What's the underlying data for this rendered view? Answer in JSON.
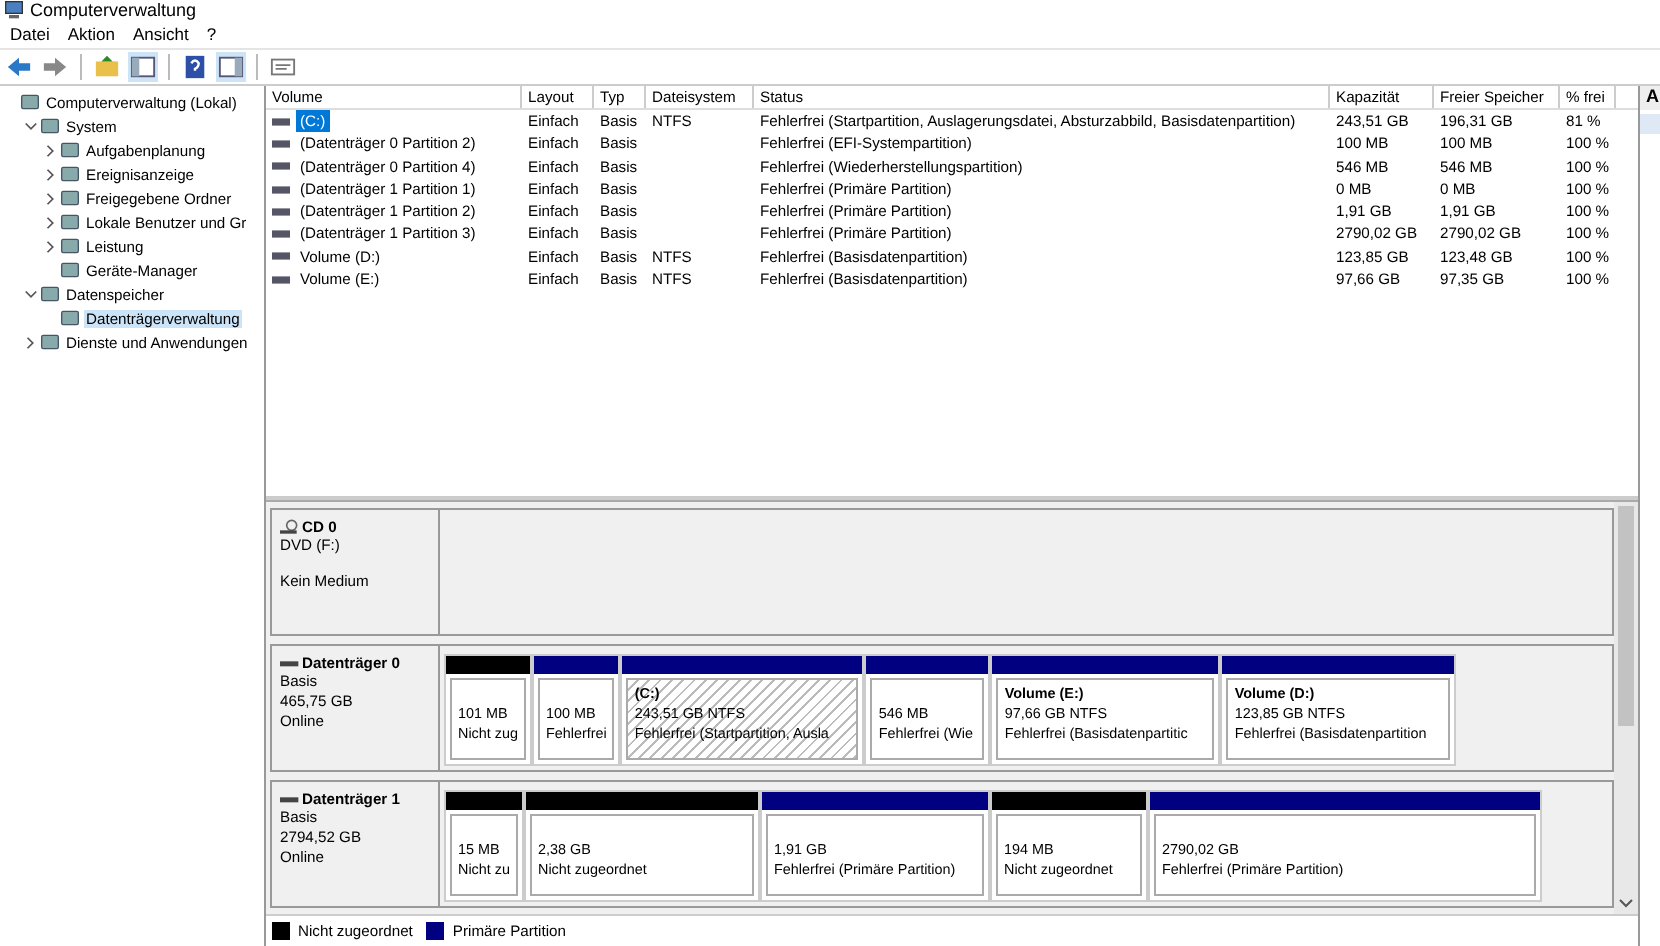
{
  "window": {
    "title": "Computerverwaltung"
  },
  "menu": [
    "Datei",
    "Aktion",
    "Ansicht",
    "?"
  ],
  "tree": [
    {
      "label": "Computerverwaltung (Lokal)",
      "selected": false,
      "children": [
        {
          "label": "System",
          "expanded": true,
          "selected": false,
          "children": [
            {
              "label": "Aufgabenplanung",
              "expanded": false,
              "selected": false
            },
            {
              "label": "Ereignisanzeige",
              "expanded": false,
              "selected": false
            },
            {
              "label": "Freigegebene Ordner",
              "expanded": false,
              "selected": false
            },
            {
              "label": "Lokale Benutzer und Gr",
              "expanded": false,
              "selected": false
            },
            {
              "label": "Leistung",
              "expanded": false,
              "selected": false
            },
            {
              "label": "Geräte-Manager",
              "selected": false
            }
          ]
        },
        {
          "label": "Datenspeicher",
          "expanded": true,
          "selected": false,
          "children": [
            {
              "label": "Datenträgerverwaltung",
              "selected": true
            }
          ]
        },
        {
          "label": "Dienste und Anwendungen",
          "expanded": false,
          "selected": false
        }
      ]
    }
  ],
  "table": {
    "columns": [
      "Volume",
      "Layout",
      "Typ",
      "Dateisystem",
      "Status",
      "Kapazität",
      "Freier Speicher",
      "% frei"
    ],
    "rows": [
      {
        "selected": true,
        "volume": "(C:)",
        "layout": "Einfach",
        "type": "Basis",
        "filesystem": "NTFS",
        "status": "Fehlerfrei (Startpartition, Auslagerungsdatei, Absturzabbild, Basisdatenpartition)",
        "capacity": "243,51 GB",
        "free": "196,31 GB",
        "free_pct": "81 %"
      },
      {
        "selected": false,
        "volume": "(Datenträger 0 Partition 2)",
        "layout": "Einfach",
        "type": "Basis",
        "status": "Fehlerfrei (EFI-Systempartition)",
        "capacity": "100 MB",
        "free": "100 MB",
        "free_pct": "100 %"
      },
      {
        "selected": false,
        "volume": "(Datenträger 0 Partition 4)",
        "layout": "Einfach",
        "type": "Basis",
        "status": "Fehlerfrei (Wiederherstellungspartition)",
        "capacity": "546 MB",
        "free": "546 MB",
        "free_pct": "100 %"
      },
      {
        "selected": false,
        "volume": "(Datenträger 1 Partition 1)",
        "layout": "Einfach",
        "type": "Basis",
        "status": "Fehlerfrei (Primäre Partition)",
        "capacity": "0 MB",
        "free": "0 MB",
        "free_pct": "100 %"
      },
      {
        "selected": false,
        "volume": "(Datenträger 1 Partition 2)",
        "layout": "Einfach",
        "type": "Basis",
        "status": "Fehlerfrei (Primäre Partition)",
        "capacity": "1,91 GB",
        "free": "1,91 GB",
        "free_pct": "100 %"
      },
      {
        "selected": false,
        "volume": "(Datenträger 1 Partition 3)",
        "layout": "Einfach",
        "type": "Basis",
        "status": "Fehlerfrei (Primäre Partition)",
        "capacity": "2790,02 GB",
        "free": "2790,02 GB",
        "free_pct": "100 %"
      },
      {
        "selected": false,
        "volume": "Volume (D:)",
        "layout": "Einfach",
        "type": "Basis",
        "filesystem": "NTFS",
        "status": "Fehlerfrei (Basisdatenpartition)",
        "capacity": "123,85 GB",
        "free": "123,48 GB",
        "free_pct": "100 %"
      },
      {
        "selected": false,
        "volume": "Volume (E:)",
        "layout": "Einfach",
        "type": "Basis",
        "filesystem": "NTFS",
        "status": "Fehlerfrei (Basisdatenpartition)",
        "capacity": "97,66 GB",
        "free": "97,35 GB",
        "free_pct": "100 %"
      }
    ]
  },
  "actions": {
    "header": "A"
  },
  "disks": [
    {
      "kind": "cdrom",
      "name": "CD 0",
      "lines": [
        "DVD (F:)",
        "Kein Medium"
      ]
    },
    {
      "kind": "disk",
      "name": "Datenträger 0",
      "lines": [
        "Basis",
        "465,75 GB",
        "Online"
      ],
      "partitions": [
        {
          "kind": "unallocated",
          "selected": false,
          "size": "101 MB",
          "status": "Nicht zug"
        },
        {
          "kind": "primary",
          "selected": false,
          "size": "100 MB",
          "status": "Fehlerfrei"
        },
        {
          "kind": "primary",
          "selected": true,
          "title": "(C:)",
          "size": "243,51 GB NTFS",
          "status": "Fehlerfrei (Startpartition, Ausla"
        },
        {
          "kind": "primary",
          "selected": false,
          "size": "546 MB",
          "status": "Fehlerfrei (Wie"
        },
        {
          "kind": "primary",
          "selected": false,
          "title": "Volume  (E:)",
          "size": "97,66 GB NTFS",
          "status": "Fehlerfrei (Basisdatenpartitic"
        },
        {
          "kind": "primary",
          "selected": false,
          "title": "Volume  (D:)",
          "size": "123,85 GB NTFS",
          "status": "Fehlerfrei (Basisdatenpartition"
        }
      ]
    },
    {
      "kind": "disk",
      "name": "Datenträger 1",
      "lines": [
        "Basis",
        "2794,52 GB",
        "Online"
      ],
      "partitions": [
        {
          "kind": "unallocated",
          "selected": false,
          "size": "15 MB",
          "status": "Nicht zu"
        },
        {
          "kind": "unallocated",
          "selected": false,
          "size": "2,38 GB",
          "status": "Nicht zugeordnet"
        },
        {
          "kind": "primary",
          "selected": false,
          "size": "1,91 GB",
          "status": "Fehlerfrei (Primäre Partition)"
        },
        {
          "kind": "unallocated",
          "selected": false,
          "size": "194 MB",
          "status": "Nicht zugeordnet"
        },
        {
          "kind": "primary",
          "selected": false,
          "size": "2790,02 GB",
          "status": "Fehlerfrei (Primäre Partition)"
        }
      ]
    }
  ],
  "legend": [
    {
      "label": "Nicht zugeordnet",
      "color": "#000000"
    },
    {
      "label": "Primäre Partition",
      "color": "#000080"
    }
  ]
}
